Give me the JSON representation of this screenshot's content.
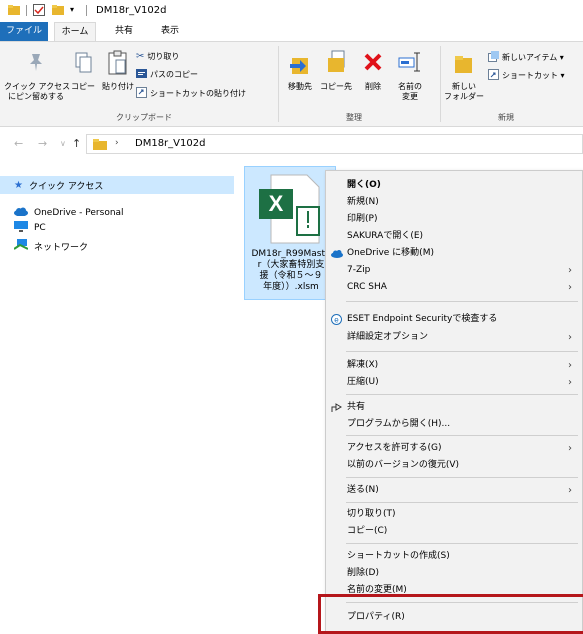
{
  "window": {
    "title": "DM18r_V102d"
  },
  "ribbon": {
    "tabs": {
      "file": "ファイル",
      "home": "ホーム",
      "share": "共有",
      "view": "表示"
    },
    "clipboard": {
      "pin_label_1": "クイック アクセス",
      "pin_label_2": "にピン留めする",
      "copy": "コピー",
      "paste": "貼り付け",
      "cut": "切り取り",
      "copy_path": "パスのコピー",
      "paste_shortcut": "ショートカットの貼り付け",
      "group": "クリップボード"
    },
    "organize": {
      "move_to": "移動先",
      "copy_to": "コピー先",
      "delete": "削除",
      "rename_1": "名前の",
      "rename_2": "変更",
      "group": "整理"
    },
    "new": {
      "new_folder_1": "新しい",
      "new_folder_2": "フォルダー",
      "new_item": "新しいアイテム ▾",
      "shortcut": "ショートカット ▾",
      "group": "新規"
    }
  },
  "address": {
    "path": "DM18r_V102d"
  },
  "navpane": {
    "quick_access": "クイック アクセス",
    "onedrive": "OneDrive - Personal",
    "pc": "PC",
    "network": "ネットワーク"
  },
  "file": {
    "name_lines": [
      "DM18r_R99Maste",
      "r（大家畜特別支",
      "援（令和５～９",
      "年度））.xlsm"
    ]
  },
  "context_menu": {
    "open": "開く(O)",
    "new": "新規(N)",
    "print": "印刷(P)",
    "sakura": "SAKURAで開く(E)",
    "onedrive_move": "OneDrive に移動(M)",
    "zip": "7-Zip",
    "crc": "CRC SHA",
    "eset": "ESET Endpoint Securityで検査する",
    "advanced": "詳細設定オプション",
    "extract": "解凍(X)",
    "compress": "圧縮(U)",
    "share": "共有",
    "open_with": "プログラムから開く(H)...",
    "grant_access": "アクセスを許可する(G)",
    "restore": "以前のバージョンの復元(V)",
    "send_to": "送る(N)",
    "cut": "切り取り(T)",
    "copy": "コピー(C)",
    "create_shortcut": "ショートカットの作成(S)",
    "delete": "削除(D)",
    "rename": "名前の変更(M)",
    "properties": "プロパティ(R)"
  },
  "colors": {
    "file_tab": "#1e6fba",
    "selection": "#cce8ff",
    "highlight_box": "#b5161b"
  }
}
